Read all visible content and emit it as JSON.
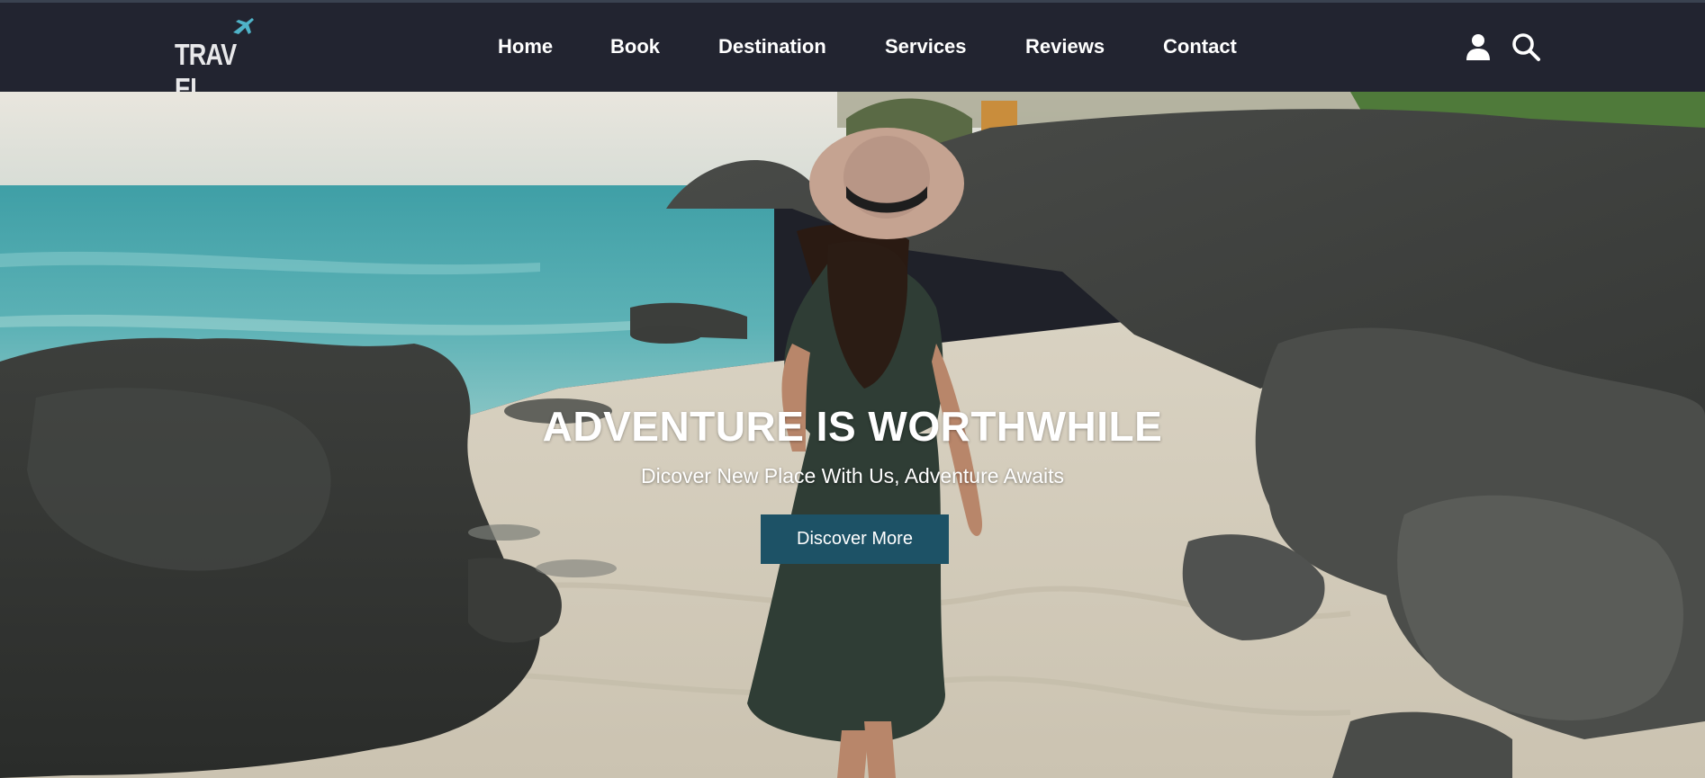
{
  "brand": {
    "logo_text": "TRAV EL"
  },
  "nav": {
    "items": [
      {
        "label": "Home"
      },
      {
        "label": "Book"
      },
      {
        "label": "Destination"
      },
      {
        "label": "Services"
      },
      {
        "label": "Reviews"
      },
      {
        "label": "Contact"
      }
    ]
  },
  "header_icons": [
    "user-icon",
    "search-icon"
  ],
  "hero": {
    "title": "ADVENTURE IS WORTHWHILE",
    "subtitle": "Dicover New Place With Us, Adventure Awaits",
    "button_label": "Discover More"
  },
  "colors": {
    "header_bg": "#222430",
    "button_bg": "#1d5266",
    "text": "#ffffff",
    "plane_accent": "#4fb3c8"
  }
}
